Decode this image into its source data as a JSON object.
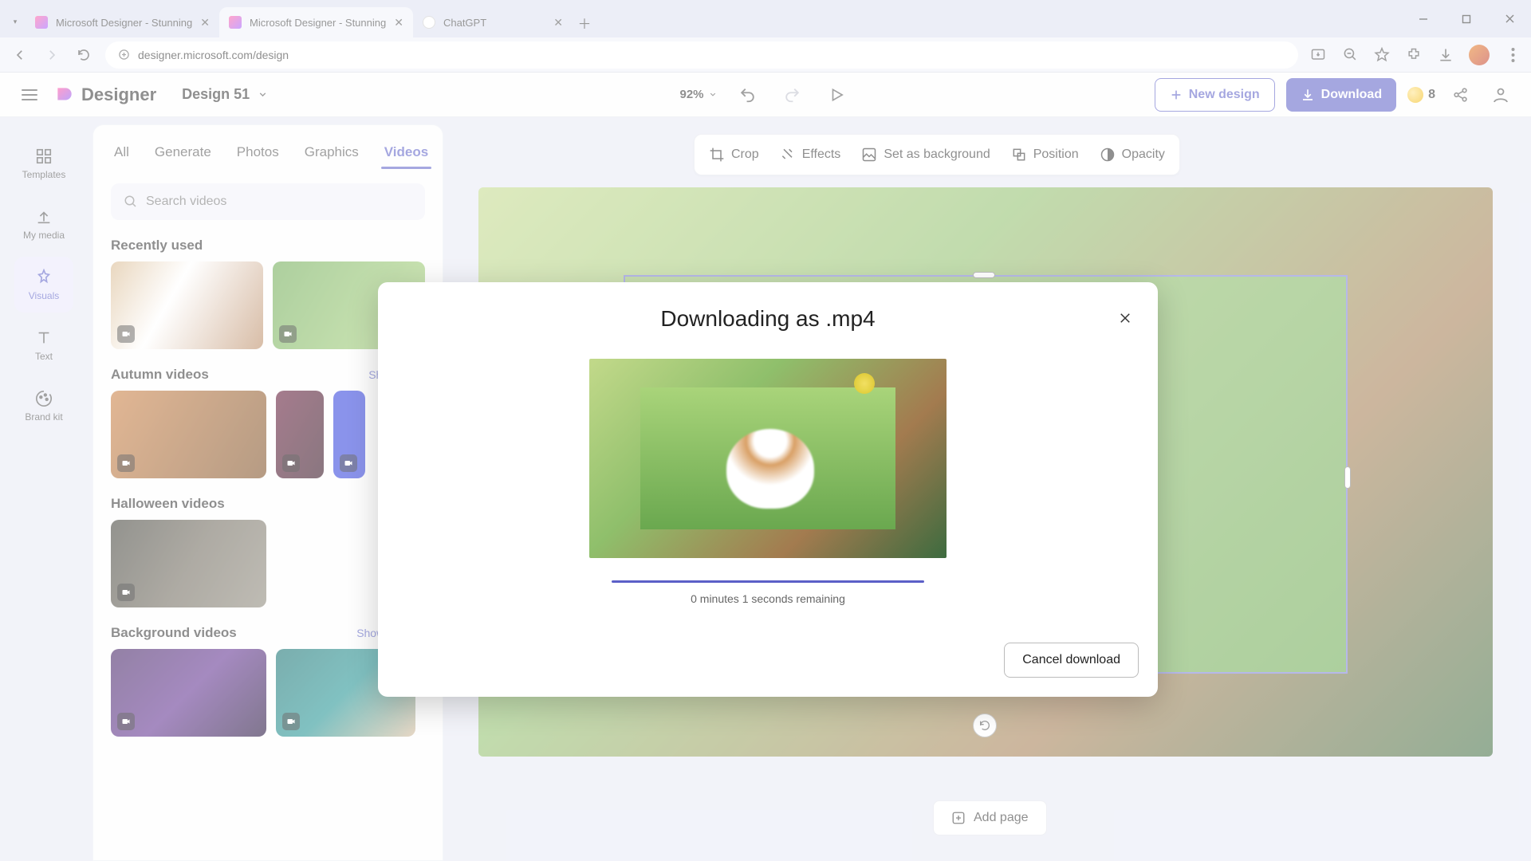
{
  "browser": {
    "tabs": [
      {
        "title": "Microsoft Designer - Stunning"
      },
      {
        "title": "Microsoft Designer - Stunning"
      },
      {
        "title": "ChatGPT"
      }
    ],
    "url": "designer.microsoft.com/design"
  },
  "header": {
    "app_name": "Designer",
    "project_name": "Design 51",
    "zoom": "92%",
    "new_design": "New design",
    "download": "Download",
    "credits": "8"
  },
  "left_rail": {
    "templates": "Templates",
    "my_media": "My media",
    "visuals": "Visuals",
    "text": "Text",
    "brand_kit": "Brand kit"
  },
  "side_panel": {
    "tabs": {
      "all": "All",
      "generate": "Generate",
      "photos": "Photos",
      "graphics": "Graphics",
      "videos": "Videos"
    },
    "search_placeholder": "Search videos",
    "sections": {
      "recent": "Recently used",
      "autumn": "Autumn videos",
      "halloween": "Halloween videos",
      "background": "Background videos"
    },
    "show_more": "Show more"
  },
  "canvas_toolbar": {
    "crop": "Crop",
    "effects": "Effects",
    "set_bg": "Set as background",
    "position": "Position",
    "opacity": "Opacity"
  },
  "add_page": "Add page",
  "modal": {
    "title": "Downloading as .mp4",
    "remaining": "0 minutes 1 seconds remaining",
    "cancel": "Cancel download"
  }
}
